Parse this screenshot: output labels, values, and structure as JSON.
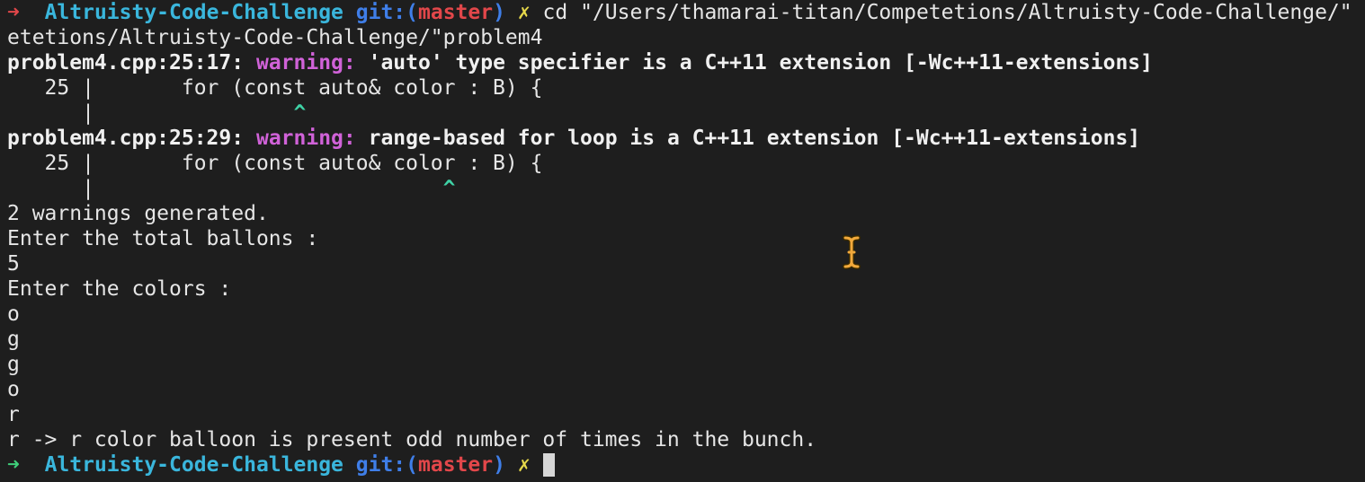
{
  "prompt": {
    "arrow": "➜",
    "directory": "Altruisty-Code-Challenge",
    "git_prefix": "git:(",
    "branch": "master",
    "git_suffix": ")",
    "dirty_mark": "✗"
  },
  "lines": {
    "command": "cd \"/Users/thamarai-titan/Competetions/Altruisty-Code-Challenge/\"",
    "wrapped": "etetions/Altruisty-Code-Challenge/\"problem4",
    "w1_loc": "problem4.cpp:25:17:",
    "w1_label": "warning:",
    "w1_msg": "'auto' type specifier is a C++11 extension [-Wc++11-extensions]",
    "w1_src": "   25 |       for (const auto& color : B) {",
    "w1_pipe": "      |",
    "w1_caret": "^",
    "w2_loc": "problem4.cpp:25:29:",
    "w2_label": "warning:",
    "w2_msg": "range-based for loop is a C++11 extension [-Wc++11-extensions]",
    "w2_src": "   25 |       for (const auto& color : B) {",
    "w2_pipe": "      |",
    "w2_caret": "^",
    "generated": "2 warnings generated.",
    "ask_total": "Enter the total ballons :",
    "total": "5",
    "ask_colors": "Enter the colors :",
    "c1": "o",
    "c2": "g",
    "c3": "g",
    "c4": "o",
    "c5": "r",
    "result": "r -> r color balloon is present odd number of times in the bunch."
  },
  "colors": {
    "background": "#1e1e1e",
    "foreground": "#e6e6e6",
    "error_arrow": "#e2474a",
    "ok_arrow": "#3fcf7a",
    "directory": "#3ab6dc",
    "git": "#3f7ee8",
    "branch": "#e2474a",
    "dirty": "#e6d84a",
    "warning": "#d062d8",
    "caret": "#3fd2a6"
  },
  "icons": {
    "mouse_pointer": "text-cursor-ibeam-icon",
    "terminal_cursor": "block-cursor-icon"
  }
}
